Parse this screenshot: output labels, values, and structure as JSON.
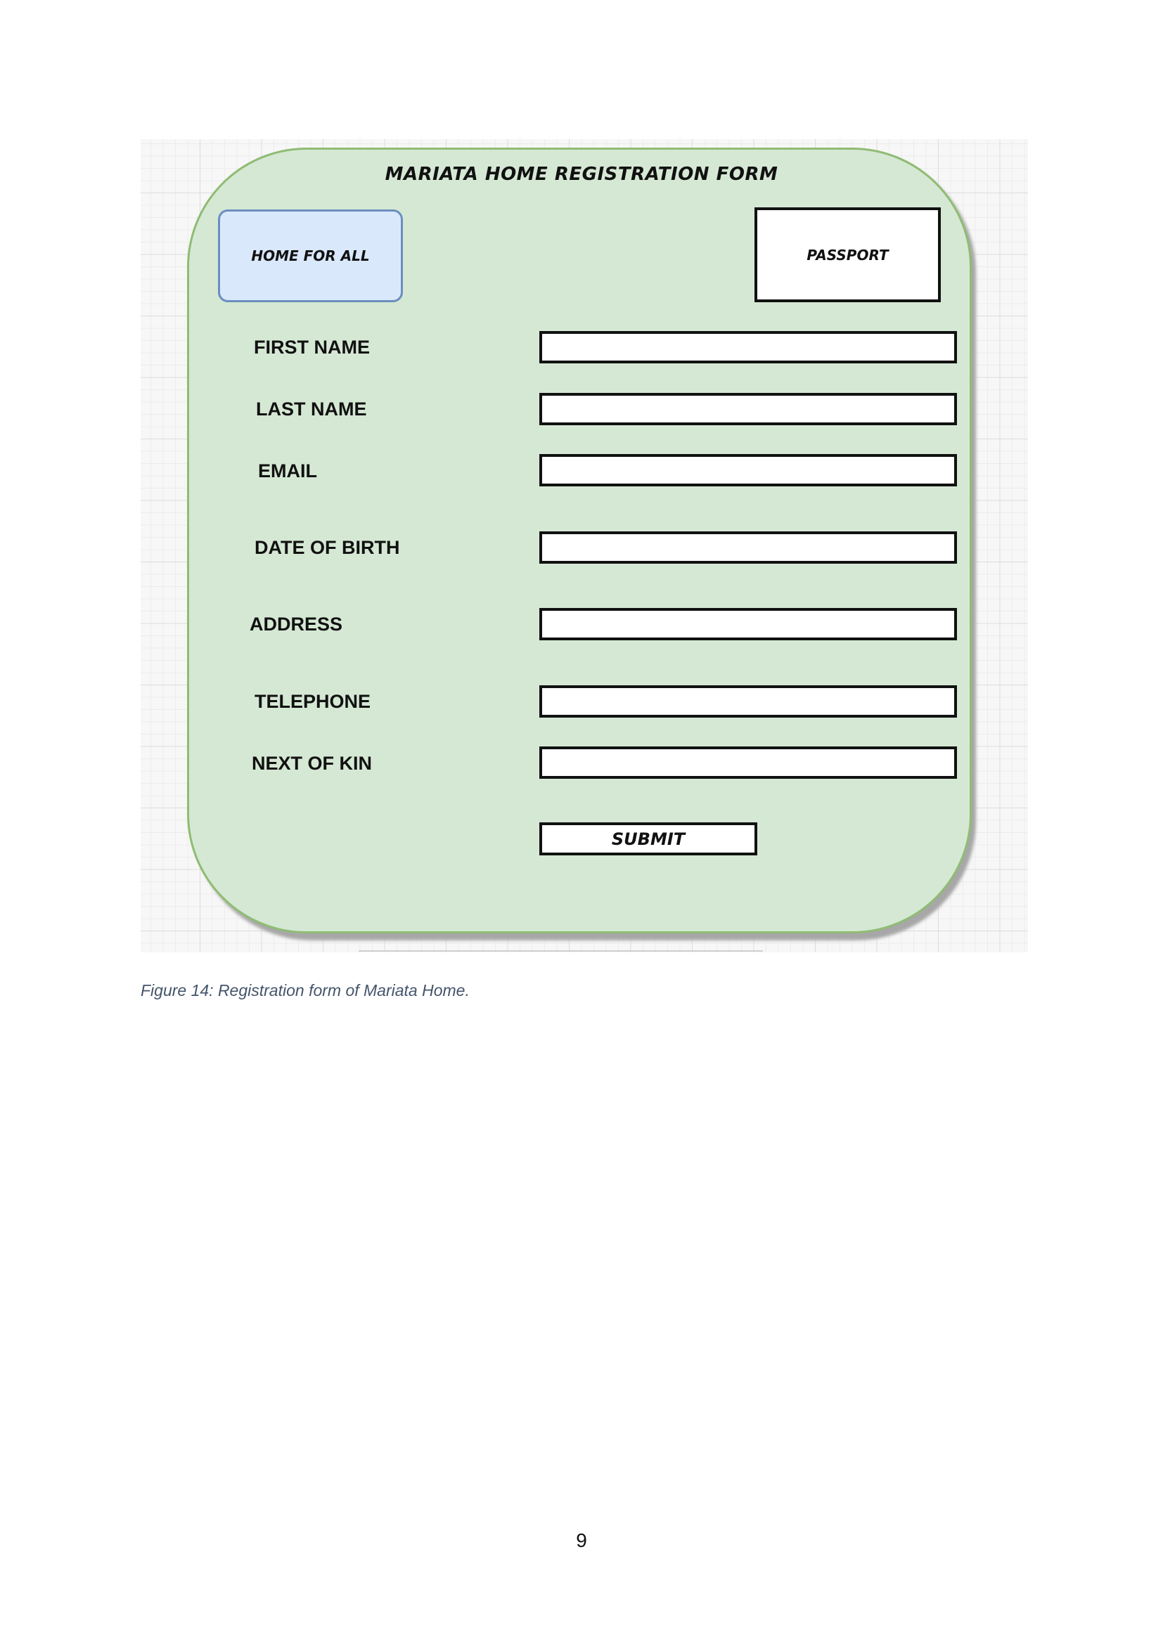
{
  "form": {
    "title": "MARIATA HOME REGISTRATION FORM",
    "logo_text": "HOME FOR ALL",
    "passport_text": "PASSPORT",
    "fields": [
      {
        "label": "FIRST NAME",
        "value": ""
      },
      {
        "label": "LAST NAME",
        "value": ""
      },
      {
        "label": "EMAIL",
        "value": ""
      },
      {
        "label": "DATE OF BIRTH",
        "value": ""
      },
      {
        "label": "ADDRESS",
        "value": ""
      },
      {
        "label": "TELEPHONE",
        "value": ""
      },
      {
        "label": "NEXT OF KIN",
        "value": ""
      }
    ],
    "submit_label": "SUBMIT"
  },
  "caption": "Figure 14: Registration form of Mariata Home.",
  "page_number": "9",
  "colors": {
    "form_fill": "#d5e8d4",
    "form_border": "#8fbc73",
    "logo_fill": "#dae8fc",
    "logo_border": "#6c8ebf",
    "caption": "#44546a"
  }
}
